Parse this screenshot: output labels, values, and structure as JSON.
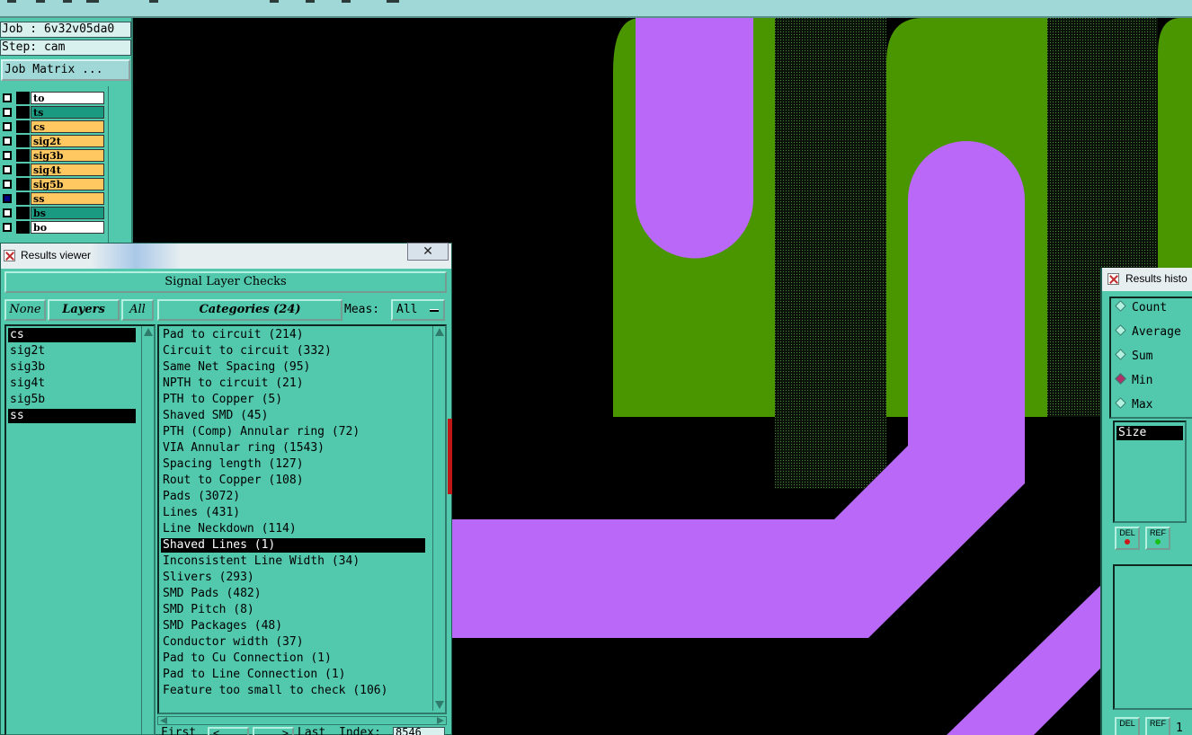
{
  "job_label": "Job : 6v32v05da0",
  "step_label": "Step: cam",
  "job_matrix_button": "Job Matrix ...",
  "layers": [
    {
      "name": "to",
      "color": "#ffffff",
      "checked": false
    },
    {
      "name": "ts",
      "color": "#1a9a80",
      "checked": false
    },
    {
      "name": "cs",
      "color": "#ffc860",
      "checked": false
    },
    {
      "name": "sig2t",
      "color": "#ffc860",
      "checked": false
    },
    {
      "name": "sig3b",
      "color": "#ffc860",
      "checked": false
    },
    {
      "name": "sig4t",
      "color": "#ffc860",
      "checked": false
    },
    {
      "name": "sig5b",
      "color": "#ffc860",
      "checked": false
    },
    {
      "name": "ss",
      "color": "#ffc860",
      "checked": true,
      "active": true
    },
    {
      "name": "bs",
      "color": "#1a9a80",
      "checked": false
    },
    {
      "name": "bo",
      "color": "#ffffff",
      "checked": false
    }
  ],
  "results_viewer": {
    "title": "Results viewer",
    "close_glyph": "✕",
    "section_header": "Signal Layer Checks",
    "none_button": "None",
    "layers_button": "Layers",
    "all_button": "All",
    "categories_button": "Categories (24)",
    "meas_label": "Meas:",
    "meas_value": "All",
    "layer_list": [
      "cs",
      "sig2t",
      "sig3b",
      "sig4t",
      "sig5b",
      "ss"
    ],
    "categories": [
      "Pad to circuit (214)",
      "Circuit to circuit (332)",
      "Same Net Spacing (95)",
      "NPTH to circuit (21)",
      "PTH to Copper (5)",
      "Shaved SMD (45)",
      "PTH (Comp) Annular ring (72)",
      "VIA Annular ring (1543)",
      "Spacing length (127)",
      "Rout to Copper (108)",
      "Pads (3072)",
      "Lines (431)",
      "Line Neckdown (114)",
      "Shaved Lines (1)",
      "Inconsistent Line Width (34)",
      "Slivers (293)",
      "SMD Pads (482)",
      "SMD Pitch (8)",
      "SMD Packages (48)",
      "Conductor width (37)",
      "Pad to Cu Connection (1)",
      "Pad to Line Connection (1)",
      "Feature too small to check (106)"
    ],
    "selected_category": "Shaved Lines (1)",
    "nav_first": "First",
    "nav_prev": "<",
    "nav_next": ">",
    "nav_last": "Last",
    "index_label": "Index:",
    "index_value": "8546"
  },
  "results_histogram": {
    "title": "Results histo",
    "options": [
      "Count",
      "Average",
      "Sum",
      "Min",
      "Max"
    ],
    "selected_option": "Min",
    "size_item": "Size",
    "del_label": "DEL",
    "ref_label": "REF",
    "bottom_value": "1"
  },
  "colors": {
    "panel": "#52c8ad",
    "copper_green": "#4a9600",
    "trace_purple": "#b968f7",
    "canvas": "#000000"
  }
}
